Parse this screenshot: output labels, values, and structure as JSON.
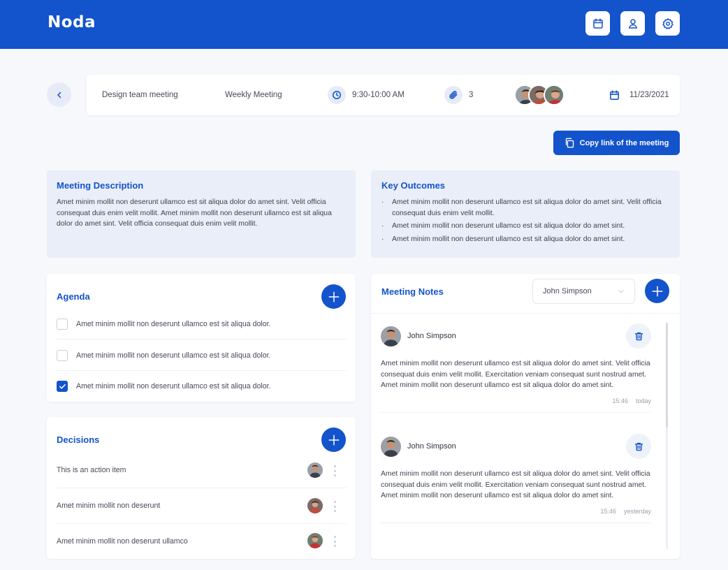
{
  "app": {
    "name": "Noda"
  },
  "topbar": {
    "icons": [
      "calendar-icon",
      "user-icon",
      "gear-icon"
    ]
  },
  "meeting": {
    "title": "Design team meeting",
    "type": "Weekly Meeting",
    "time": "9:30-10:00 AM",
    "attachments": "3",
    "date": "11/23/2021"
  },
  "copy_link": {
    "label": "Copy link of the meeting"
  },
  "description": {
    "title": "Meeting Description",
    "text": "Amet minim mollit non deserunt ullamco est sit aliqua dolor do amet sint. Velit officia consequat duis enim velit mollit. Amet minim mollit non deserunt ullamco est sit aliqua dolor do amet sint. Velit officia consequat duis enim velit mollit."
  },
  "outcomes": {
    "title": "Key Outcomes",
    "items": [
      "Amet minim mollit non deserunt ullamco est sit aliqua dolor do amet sint. Velit officia consequat duis enim velit mollit.",
      "Amet minim mollit non deserunt ullamco est sit aliqua dolor do amet sint.",
      "Amet minim mollit non deserunt ullamco est sit aliqua dolor do amet sint."
    ]
  },
  "agenda": {
    "title": "Agenda",
    "items": [
      {
        "text": "Amet minim mollit non deserunt ullamco est sit aliqua dolor.",
        "checked": false
      },
      {
        "text": "Amet minim mollit non deserunt ullamco est sit aliqua dolor.",
        "checked": false
      },
      {
        "text": "Amet minim mollit non deserunt ullamco est sit aliqua dolor.",
        "checked": true
      }
    ]
  },
  "decisions": {
    "title": "Decisions",
    "items": [
      {
        "text": "This is an action item"
      },
      {
        "text": "Amet minim mollit non deserunt"
      },
      {
        "text": "Amet minim mollit non deserunt ullamco"
      }
    ]
  },
  "notes": {
    "title": "Meeting Notes",
    "filter": "John Simpson",
    "items": [
      {
        "author": "John Simpson",
        "text": "Amet minim mollit non deserunt ullamco est sit aliqua dolor do amet sint. Velit officia consequat duis enim velit mollit. Exercitation veniam consequat sunt nostrud amet. Amet minim mollit non deserunt ullamco est sit aliqua dolor do amet sint.",
        "time": "15:46",
        "day": "today"
      },
      {
        "author": "John Simpson",
        "text": "Amet minim mollit non deserunt ullamco est sit aliqua dolor do amet sint. Velit officia consequat duis enim velit mollit. Exercitation veniam consequat sunt nostrud amet. Amet minim mollit non deserunt ullamco est sit aliqua dolor do amet sint.",
        "time": "15:46",
        "day": "yesterday"
      }
    ]
  },
  "colors": {
    "primary": "#1353cc",
    "background": "#f7f8fb",
    "tint": "#e9eef8"
  }
}
